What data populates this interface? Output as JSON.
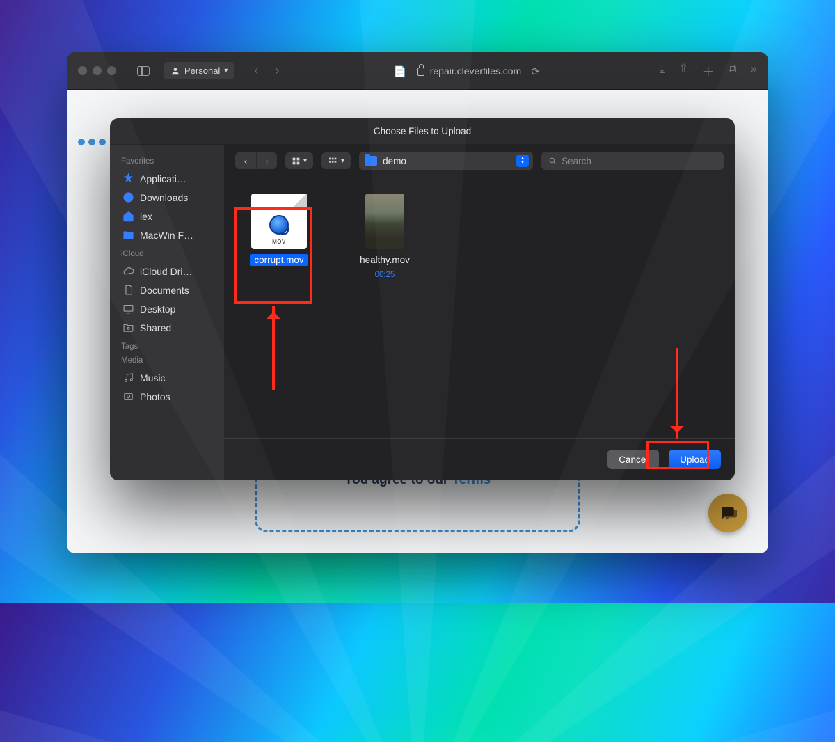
{
  "browser": {
    "profile_label": "Personal",
    "address": "repair.cleverfiles.com",
    "terms_prefix": "You agree to our ",
    "terms_link": "Terms"
  },
  "dialog": {
    "title": "Choose Files to Upload",
    "path_label": "demo",
    "search_placeholder": "Search",
    "cancel": "Cancel",
    "upload": "Upload"
  },
  "sidebar": {
    "favorites_heading": "Favorites",
    "favorites": [
      {
        "label": "Applicati…",
        "icon": "apps"
      },
      {
        "label": "Downloads",
        "icon": "downloads"
      },
      {
        "label": "lex",
        "icon": "home"
      },
      {
        "label": "MacWin F…",
        "icon": "folder"
      }
    ],
    "icloud_heading": "iCloud",
    "icloud": [
      {
        "label": "iCloud Dri…",
        "icon": "cloud"
      },
      {
        "label": "Documents",
        "icon": "document"
      },
      {
        "label": "Desktop",
        "icon": "desktop"
      },
      {
        "label": "Shared",
        "icon": "shared"
      }
    ],
    "tags_heading": "Tags",
    "media_heading": "Media",
    "media": [
      {
        "label": "Music",
        "icon": "music"
      },
      {
        "label": "Photos",
        "icon": "photos"
      }
    ]
  },
  "files": [
    {
      "name": "corrupt.mov",
      "kind": "mov-doc",
      "ext_badge": "MOV",
      "selected": true
    },
    {
      "name": "healthy.mov",
      "kind": "video",
      "duration": "00:25",
      "selected": false
    }
  ]
}
